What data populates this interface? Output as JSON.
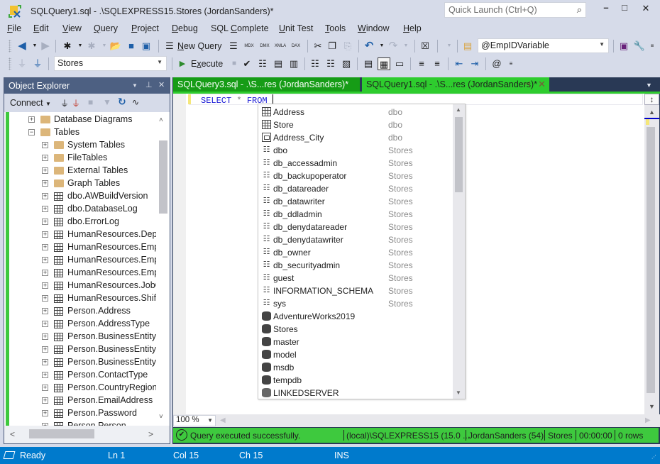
{
  "window": {
    "title": "SQLQuery1.sql - .\\SQLEXPRESS15.Stores (JordanSanders)*",
    "quick_launch_placeholder": "Quick Launch (Ctrl+Q)",
    "minimize": "–",
    "maximize": "□",
    "close": "✕"
  },
  "menu": [
    {
      "label": "File",
      "underline": "F",
      "rest": "ile"
    },
    {
      "label": "Edit",
      "underline": "E",
      "rest": "dit"
    },
    {
      "label": "View",
      "underline": "V",
      "rest": "iew"
    },
    {
      "label": "Query",
      "underline": "Q",
      "rest": "uery"
    },
    {
      "label": "Project",
      "underline": "P",
      "rest": "roject"
    },
    {
      "label": "Debug",
      "underline": "D",
      "rest": "ebug"
    },
    {
      "label": "SQL Complete",
      "pre": "SQL ",
      "underline": "C",
      "rest": "omplete"
    },
    {
      "label": "Unit Test",
      "underline": "U",
      "rest": "nit Test"
    },
    {
      "label": "Tools",
      "underline": "T",
      "rest": "ools"
    },
    {
      "label": "Window",
      "underline": "W",
      "rest": "indow"
    },
    {
      "label": "Help",
      "underline": "H",
      "rest": "elp"
    }
  ],
  "toolbar1": {
    "new_query_label": "New Query",
    "new_query_underline": "N",
    "new_query_rest": "ew Query",
    "variable_combo": "@EmpIDVariable",
    "mdx": "MDX",
    "dmx": "DMX",
    "xmla": "XMLA",
    "dax": "DAX"
  },
  "toolbar2": {
    "database_combo": "Stores",
    "execute_label": "Execute",
    "execute_pre": "E",
    "execute_underline": "x",
    "execute_rest": "ecute"
  },
  "object_explorer": {
    "title": "Object Explorer",
    "connect_label": "Connect",
    "tree": [
      {
        "label": "Database Diagrams",
        "type": "folder",
        "level": 0,
        "expander": "+"
      },
      {
        "label": "Tables",
        "type": "folder",
        "level": 0,
        "expander": "−"
      },
      {
        "label": "System Tables",
        "type": "folder",
        "level": 1,
        "expander": "+"
      },
      {
        "label": "FileTables",
        "type": "folder",
        "level": 1,
        "expander": "+"
      },
      {
        "label": "External Tables",
        "type": "folder",
        "level": 1,
        "expander": "+"
      },
      {
        "label": "Graph Tables",
        "type": "folder",
        "level": 1,
        "expander": "+"
      },
      {
        "label": "dbo.AWBuildVersion",
        "type": "table",
        "level": 1,
        "expander": "+"
      },
      {
        "label": "dbo.DatabaseLog",
        "type": "table",
        "level": 1,
        "expander": "+"
      },
      {
        "label": "dbo.ErrorLog",
        "type": "table",
        "level": 1,
        "expander": "+"
      },
      {
        "label": "HumanResources.Depa",
        "type": "table",
        "level": 1,
        "expander": "+"
      },
      {
        "label": "HumanResources.Empl",
        "type": "table",
        "level": 1,
        "expander": "+"
      },
      {
        "label": "HumanResources.Empl",
        "type": "table",
        "level": 1,
        "expander": "+"
      },
      {
        "label": "HumanResources.Empl",
        "type": "table",
        "level": 1,
        "expander": "+"
      },
      {
        "label": "HumanResources.JobCa",
        "type": "table",
        "level": 1,
        "expander": "+"
      },
      {
        "label": "HumanResources.Shift",
        "type": "table",
        "level": 1,
        "expander": "+"
      },
      {
        "label": "Person.Address",
        "type": "table",
        "level": 1,
        "expander": "+"
      },
      {
        "label": "Person.AddressType",
        "type": "table",
        "level": 1,
        "expander": "+"
      },
      {
        "label": "Person.BusinessEntity",
        "type": "table",
        "level": 1,
        "expander": "+"
      },
      {
        "label": "Person.BusinessEntityA",
        "type": "table",
        "level": 1,
        "expander": "+"
      },
      {
        "label": "Person.BusinessEntityC",
        "type": "table",
        "level": 1,
        "expander": "+"
      },
      {
        "label": "Person.ContactType",
        "type": "table",
        "level": 1,
        "expander": "+"
      },
      {
        "label": "Person.CountryRegion",
        "type": "table",
        "level": 1,
        "expander": "+"
      },
      {
        "label": "Person.EmailAddress",
        "type": "table",
        "level": 1,
        "expander": "+"
      },
      {
        "label": "Person.Password",
        "type": "table",
        "level": 1,
        "expander": "+"
      },
      {
        "label": "Person.Person",
        "type": "table",
        "level": 1,
        "expander": "+"
      }
    ]
  },
  "tabs": [
    {
      "label": "SQLQuery3.sql - .\\S...res (JordanSanders)*",
      "active": false
    },
    {
      "label": "SQLQuery1.sql - .\\S...res (JordanSanders)*",
      "active": true
    }
  ],
  "editor": {
    "keyword_select": "SELECT",
    "operator": "*",
    "keyword_from": "FROM",
    "zoom_level": "100 %"
  },
  "completion_list": [
    {
      "name": "Address",
      "schema": "dbo",
      "icon": "table"
    },
    {
      "name": "Store",
      "schema": "dbo",
      "icon": "table"
    },
    {
      "name": "Address_City",
      "schema": "dbo",
      "icon": "view"
    },
    {
      "name": "dbo",
      "schema": "Stores",
      "icon": "schema"
    },
    {
      "name": "db_accessadmin",
      "schema": "Stores",
      "icon": "schema"
    },
    {
      "name": "db_backupoperator",
      "schema": "Stores",
      "icon": "schema"
    },
    {
      "name": "db_datareader",
      "schema": "Stores",
      "icon": "schema"
    },
    {
      "name": "db_datawriter",
      "schema": "Stores",
      "icon": "schema"
    },
    {
      "name": "db_ddladmin",
      "schema": "Stores",
      "icon": "schema"
    },
    {
      "name": "db_denydatareader",
      "schema": "Stores",
      "icon": "schema"
    },
    {
      "name": "db_denydatawriter",
      "schema": "Stores",
      "icon": "schema"
    },
    {
      "name": "db_owner",
      "schema": "Stores",
      "icon": "schema"
    },
    {
      "name": "db_securityadmin",
      "schema": "Stores",
      "icon": "schema"
    },
    {
      "name": "guest",
      "schema": "Stores",
      "icon": "schema"
    },
    {
      "name": "INFORMATION_SCHEMA",
      "schema": "Stores",
      "icon": "schema"
    },
    {
      "name": "sys",
      "schema": "Stores",
      "icon": "schema"
    },
    {
      "name": "AdventureWorks2019",
      "schema": "",
      "icon": "database"
    },
    {
      "name": "Stores",
      "schema": "",
      "icon": "database"
    },
    {
      "name": "master",
      "schema": "",
      "icon": "database"
    },
    {
      "name": "model",
      "schema": "",
      "icon": "database"
    },
    {
      "name": "msdb",
      "schema": "",
      "icon": "database"
    },
    {
      "name": "tempdb",
      "schema": "",
      "icon": "database"
    },
    {
      "name": "LINKEDSERVER",
      "schema": "",
      "icon": "linked-server"
    }
  ],
  "query_status": {
    "message": "Query executed successfully.",
    "server": "(local)\\SQLEXPRESS15 (15.0 ...",
    "user": "JordanSanders (54)",
    "database": "Stores",
    "elapsed": "00:00:00",
    "rows": "0 rows"
  },
  "statusbar": {
    "state": "Ready",
    "line": "Ln 1",
    "col": "Col 15",
    "ch": "Ch 15",
    "mode": "INS"
  },
  "colors": {
    "tab_active": "#2ecc2e",
    "tab_inactive": "#169c16",
    "status_bar": "#007acc",
    "query_status_bg": "#3ec93e",
    "panel_header": "#4d6082",
    "chrome": "#d6dbe9"
  }
}
